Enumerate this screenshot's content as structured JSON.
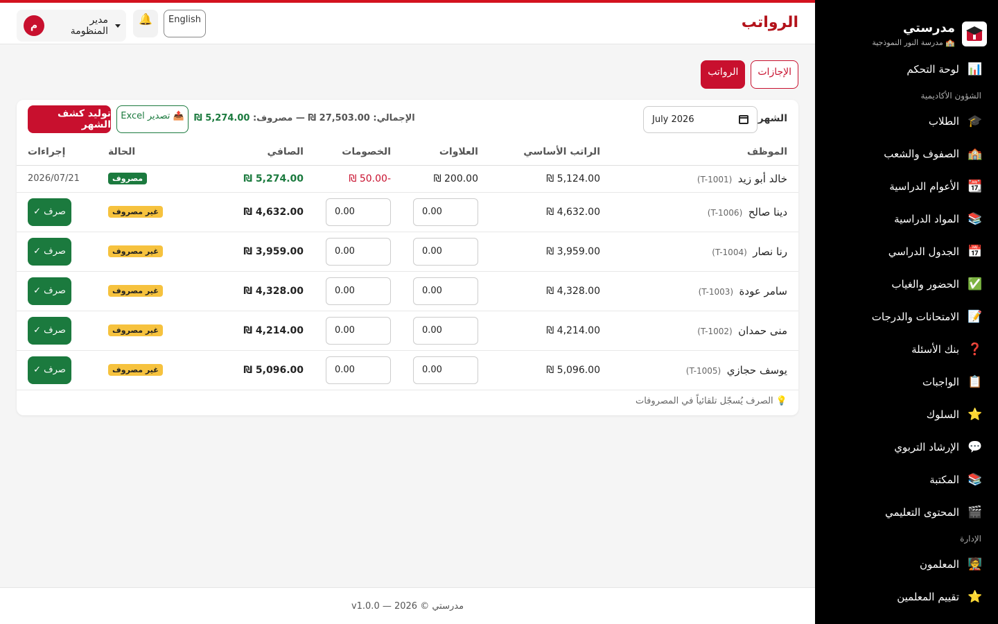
{
  "app": {
    "brand_name": "مدرستي",
    "school_name": "🏫 مدرسة النور النموذجية"
  },
  "sidebar": {
    "items_top": [
      {
        "label": "لوحة التحكم",
        "icon": "📊"
      }
    ],
    "section_academic": "الشؤون الأكاديمية",
    "items_academic": [
      {
        "label": "الطلاب",
        "icon": "🎓"
      },
      {
        "label": "الصفوف والشعب",
        "icon": "🏫"
      },
      {
        "label": "الأعوام الدراسية",
        "icon": "📆"
      },
      {
        "label": "المواد الدراسية",
        "icon": "📚"
      },
      {
        "label": "الجدول الدراسي",
        "icon": "📅"
      },
      {
        "label": "الحضور والغياب",
        "icon": "✅"
      },
      {
        "label": "الامتحانات والدرجات",
        "icon": "📝"
      },
      {
        "label": "بنك الأسئلة",
        "icon": "❓"
      },
      {
        "label": "الواجبات",
        "icon": "📋"
      },
      {
        "label": "السلوك",
        "icon": "⭐"
      },
      {
        "label": "الإرشاد التربوي",
        "icon": "💬"
      },
      {
        "label": "المكتبة",
        "icon": "📚"
      },
      {
        "label": "المحتوى التعليمي",
        "icon": "🎬"
      }
    ],
    "section_admin": "الإدارة",
    "items_admin": [
      {
        "label": "المعلمون",
        "icon": "🧑‍🏫"
      },
      {
        "label": "تقييم المعلمين",
        "icon": "⭐"
      }
    ]
  },
  "header": {
    "title": "الرواتب",
    "lang_label": "English",
    "user_initial": "م",
    "user_name": "مدير المنظومة"
  },
  "tabs": [
    {
      "label": "الإجازات",
      "active": false
    },
    {
      "label": "الرواتب",
      "active": true
    }
  ],
  "toolbar": {
    "month_label": "الشهر",
    "month_value": "July 2026",
    "totals_text": "الإجمالي: 27,503.00 ₪ — مصروف:",
    "totals_paid": "5,274.00 ₪",
    "excel_label": "📤 تصدير Excel",
    "generate_label": "توليد كشف الشهر"
  },
  "table": {
    "headers": [
      "الموظف",
      "الراتب الأساسي",
      "العلاوات",
      "الخصومات",
      "الصافي",
      "الحالة",
      "إجراءات"
    ],
    "paid_row": {
      "name": "خالد أبو زيد",
      "code": "(T-1001)",
      "base": "5,124.00 ₪",
      "allowances": "200.00 ₪",
      "deductions": "-50.00 ₪",
      "net": "5,274.00 ₪",
      "status": "مصروف",
      "date": "2026/07/21"
    },
    "unpaid_rows": [
      {
        "name": "دينا صالح",
        "code": "(T-1006)",
        "base": "4,632.00 ₪",
        "allowances": "0.00",
        "deductions": "0.00",
        "net": "4,632.00 ₪",
        "status": "غير مصروف",
        "action": "صرف ✓"
      },
      {
        "name": "رنا نصار",
        "code": "(T-1004)",
        "base": "3,959.00 ₪",
        "allowances": "0.00",
        "deductions": "0.00",
        "net": "3,959.00 ₪",
        "status": "غير مصروف",
        "action": "صرف ✓"
      },
      {
        "name": "سامر عودة",
        "code": "(T-1003)",
        "base": "4,328.00 ₪",
        "allowances": "0.00",
        "deductions": "0.00",
        "net": "4,328.00 ₪",
        "status": "غير مصروف",
        "action": "صرف ✓"
      },
      {
        "name": "منى حمدان",
        "code": "(T-1002)",
        "base": "4,214.00 ₪",
        "allowances": "0.00",
        "deductions": "0.00",
        "net": "4,214.00 ₪",
        "status": "غير مصروف",
        "action": "صرف ✓"
      },
      {
        "name": "يوسف حجازي",
        "code": "(T-1005)",
        "base": "5,096.00 ₪",
        "allowances": "0.00",
        "deductions": "0.00",
        "net": "5,096.00 ₪",
        "status": "غير مصروف",
        "action": "صرف ✓"
      }
    ]
  },
  "note": "💡 الصرف يُسجّل تلقائياً في المصروفات",
  "footer": "مدرستي © 2026 — v1.0.0",
  "colors": {
    "brand_red": "#c8102e",
    "paid_green": "#1b7a3e",
    "unpaid_yellow": "#f6c23e"
  }
}
